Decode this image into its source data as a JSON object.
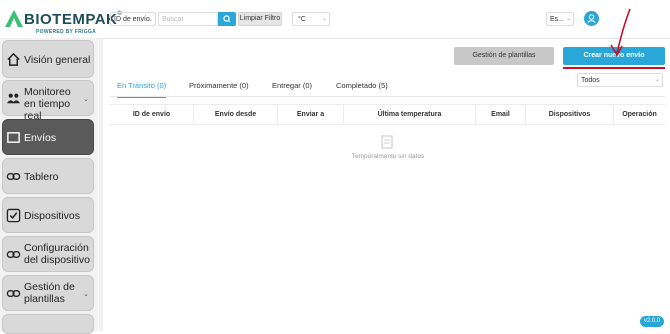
{
  "brand": {
    "name": "BIOTEMPAK",
    "reg": "®",
    "tagline": "POWERED BY FRIGGA"
  },
  "header": {
    "search_field": "ID de envío",
    "search_placeholder": "Buscar",
    "clear_label": "Limpiar Filtro",
    "unit": "°C",
    "language": "Es..."
  },
  "sidebar": {
    "items": [
      {
        "label": "Visión general",
        "icon": "home-icon"
      },
      {
        "label": "Monitoreo en tiempo real",
        "icon": "people-icon"
      },
      {
        "label": "Envíos",
        "icon": "box-icon"
      },
      {
        "label": "Tablero",
        "icon": "link-icon"
      },
      {
        "label": "Dispositivos",
        "icon": "check-icon"
      },
      {
        "label": "Configuración del dispositivo",
        "icon": "link-icon"
      },
      {
        "label": "Gestión de plantillas",
        "icon": "link-icon"
      }
    ]
  },
  "main": {
    "templates_button": "Gestión de plantillas",
    "create_button": "Crear nuevo envío",
    "filter": "Todos",
    "tabs": [
      {
        "label": "En Tránsito (0)"
      },
      {
        "label": "Próximamente (0)"
      },
      {
        "label": "Entregar (0)"
      },
      {
        "label": "Completado (5)"
      }
    ],
    "columns": [
      "ID de envío",
      "Envío desde",
      "Enviar a",
      "Última temperatura",
      "Email",
      "Dispositivos",
      "Operación"
    ],
    "empty_text": "Temporalmente sin datos",
    "version": "v2.0.0"
  },
  "colors": {
    "accent": "#2aa7d9",
    "brand": "#1f4e5a",
    "annotation": "#c8102e",
    "nav_active": "#5a5a5a"
  }
}
